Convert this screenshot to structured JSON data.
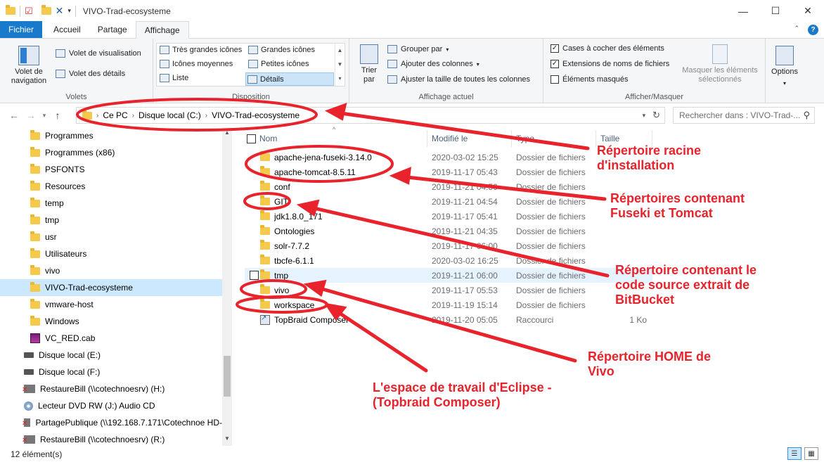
{
  "window": {
    "title": "VIVO-Trad-ecosysteme",
    "controls": [
      "—",
      "☐",
      "✕"
    ]
  },
  "ribbon_tabs": [
    "Fichier",
    "Accueil",
    "Partage",
    "Affichage"
  ],
  "ribbon": {
    "panes": {
      "label": "Volets",
      "nav_pane": "Volet de navigation",
      "preview_pane": "Volet de visualisation",
      "details_pane": "Volet des détails"
    },
    "layout": {
      "label": "Disposition",
      "items": [
        "Très grandes icônes",
        "Grandes icônes",
        "Icônes moyennes",
        "Petites icônes",
        "Liste",
        "Détails"
      ],
      "selected": "Détails"
    },
    "current_view": {
      "label": "Affichage actuel",
      "sort_by": "Trier par",
      "group_by": "Grouper par",
      "add_columns": "Ajouter des colonnes",
      "fit_columns": "Ajuster la taille de toutes les colonnes"
    },
    "show_hide": {
      "label": "Afficher/Masquer",
      "item_checkboxes": "Cases à cocher des éléments",
      "file_extensions": "Extensions de noms de fichiers",
      "hidden_items": "Éléments masqués",
      "hide_selected": "Masquer les éléments sélectionnés"
    },
    "options": "Options"
  },
  "address": {
    "crumbs": [
      "Ce PC",
      "Disque local (C:)",
      "VIVO-Trad-ecosysteme"
    ],
    "search_placeholder": "Rechercher dans : VIVO-Trad-..."
  },
  "nav_items": [
    {
      "label": "Programmes",
      "type": "folder"
    },
    {
      "label": "Programmes (x86)",
      "type": "folder"
    },
    {
      "label": "PSFONTS",
      "type": "folder"
    },
    {
      "label": "Resources",
      "type": "folder"
    },
    {
      "label": "temp",
      "type": "folder"
    },
    {
      "label": "tmp",
      "type": "folder"
    },
    {
      "label": "usr",
      "type": "folder"
    },
    {
      "label": "Utilisateurs",
      "type": "folder"
    },
    {
      "label": "vivo",
      "type": "folder"
    },
    {
      "label": "VIVO-Trad-ecosysteme",
      "type": "folder",
      "selected": true
    },
    {
      "label": "vmware-host",
      "type": "folder"
    },
    {
      "label": "Windows",
      "type": "folder"
    },
    {
      "label": "VC_RED.cab",
      "type": "cab"
    },
    {
      "label": "Disque local (E:)",
      "type": "drive"
    },
    {
      "label": "Disque local (F:)",
      "type": "drive"
    },
    {
      "label": "RestaureBill (\\\\cotechnoesrv) (H:)",
      "type": "net"
    },
    {
      "label": "Lecteur DVD RW (J:) Audio CD",
      "type": "dvd"
    },
    {
      "label": "PartagePublique (\\\\192.168.7.171\\Cotechnoe HD-",
      "type": "net"
    },
    {
      "label": "RestaureBill (\\\\cotechnoesrv) (R:)",
      "type": "net"
    }
  ],
  "columns": [
    "Nom",
    "Modifié le",
    "Type",
    "Taille"
  ],
  "files": [
    {
      "name": "apache-jena-fuseki-3.14.0",
      "modified": "2020-03-02 15:25",
      "type": "Dossier de fichiers",
      "size": "",
      "kind": "folder"
    },
    {
      "name": "apache-tomcat-8.5.11",
      "modified": "2019-11-17 05:43",
      "type": "Dossier de fichiers",
      "size": "",
      "kind": "folder"
    },
    {
      "name": "conf",
      "modified": "2019-11-21 04:50",
      "type": "Dossier de fichiers",
      "size": "",
      "kind": "folder"
    },
    {
      "name": "GIT",
      "modified": "2019-11-21 04:54",
      "type": "Dossier de fichiers",
      "size": "",
      "kind": "folder"
    },
    {
      "name": "jdk1.8.0_171",
      "modified": "2019-11-17 05:41",
      "type": "Dossier de fichiers",
      "size": "",
      "kind": "folder"
    },
    {
      "name": "Ontologies",
      "modified": "2019-11-21 04:35",
      "type": "Dossier de fichiers",
      "size": "",
      "kind": "folder"
    },
    {
      "name": "solr-7.7.2",
      "modified": "2019-11-17 06:00",
      "type": "Dossier de fichiers",
      "size": "",
      "kind": "folder"
    },
    {
      "name": "tbcfe-6.1.1",
      "modified": "2020-03-02 16:25",
      "type": "Dossier de fichiers",
      "size": "",
      "kind": "folder"
    },
    {
      "name": "tmp",
      "modified": "2019-11-21 06:00",
      "type": "Dossier de fichiers",
      "size": "",
      "kind": "folder",
      "hover": true
    },
    {
      "name": "vivo",
      "modified": "2019-11-17 05:53",
      "type": "Dossier de fichiers",
      "size": "",
      "kind": "folder"
    },
    {
      "name": "workspace",
      "modified": "2019-11-19 15:14",
      "type": "Dossier de fichiers",
      "size": "",
      "kind": "folder"
    },
    {
      "name": "TopBraid Composer",
      "modified": "2019-11-20 05:05",
      "type": "Raccourci",
      "size": "1 Ko",
      "kind": "shortcut"
    }
  ],
  "status": {
    "count": "12 élément(s)"
  },
  "annotations": [
    {
      "text": "Répertoire racine\nd'installation"
    },
    {
      "text": "Répertoires contenant\nFuseki et Tomcat"
    },
    {
      "text": "Répertoire contenant le\ncode source extrait de\nBitBucket"
    },
    {
      "text": "Répertoire HOME de\nVivo"
    },
    {
      "text": "L'espace de travail d'Eclipse -\n(Topbraid Composer)"
    }
  ],
  "colors": {
    "accent": "#1979ca",
    "selection": "#cce8ff",
    "annotation": "#e8232c",
    "folder": "#f5c94c"
  }
}
